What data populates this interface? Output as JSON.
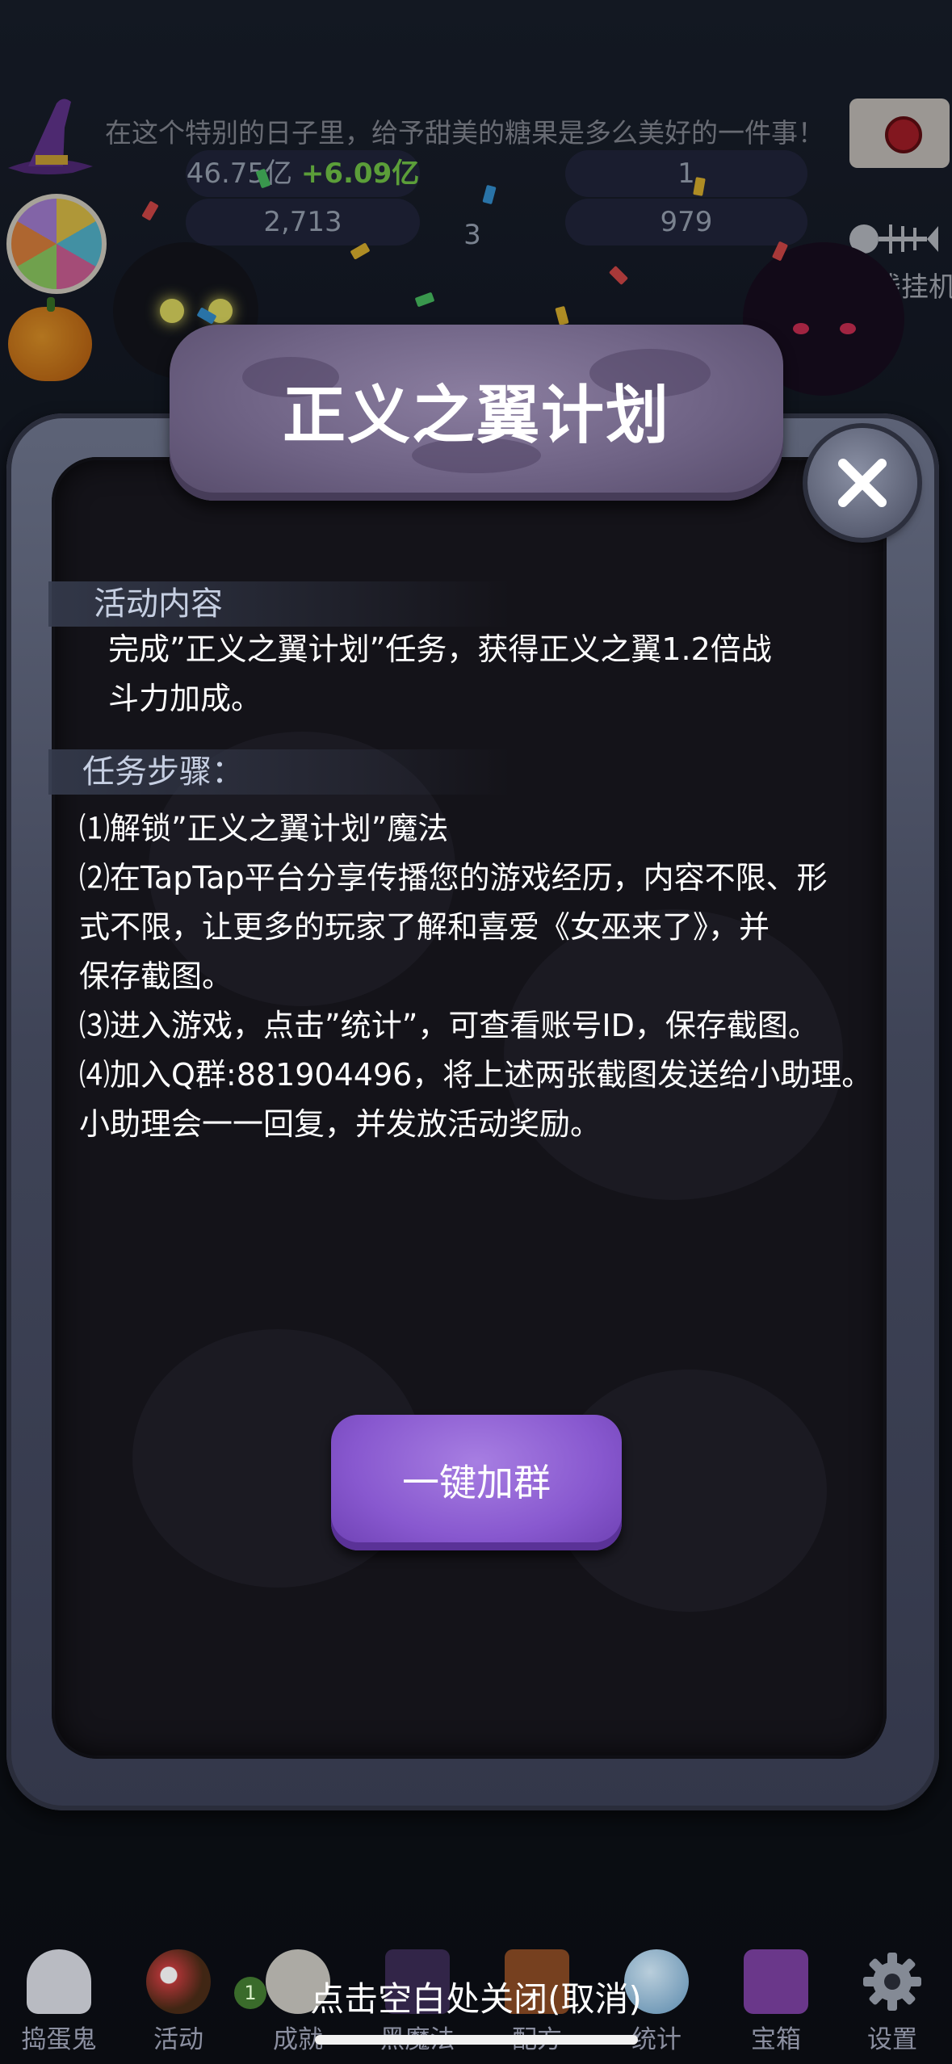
{
  "background": {
    "marquee": "在这个特别的日子里，给予甜美的糖果是多么美好的一件事！",
    "stats": {
      "coins": "46.75亿",
      "rate": "+6.09亿",
      "level": "1",
      "souls": "2,713",
      "cauldron": "3",
      "candy": "979"
    },
    "offline_label": "离线挂机"
  },
  "dialog": {
    "title": "正义之翼计划",
    "content_heading": "活动内容",
    "content_lines": [
      "完成”正义之翼计划”任务，获得正义之翼1.2倍战",
      "斗力加成。"
    ],
    "steps_heading": "任务步骤：",
    "steps_lines": [
      "⑴解锁”正义之翼计划”魔法",
      "⑵在TapTap平台分享传播您的游戏经历，内容不限、形",
      "式不限，让更多的玩家了解和喜爱《女巫来了》，并",
      "保存截图。",
      "⑶进入游戏，点击”统计”，可查看账号ID，保存截图。",
      "⑷加入Q群:881904496，将上述两张截图发送给小助理。",
      "小助理会一一回复，并发放活动奖励。"
    ],
    "join_button": "一键加群"
  },
  "tabbar": {
    "tabs": [
      {
        "label": "捣蛋鬼",
        "icon": "ghost-icon"
      },
      {
        "label": "活动",
        "icon": "eyeballs-icon"
      },
      {
        "label": "成就",
        "icon": "skull-icon"
      },
      {
        "label": "黑魔法",
        "icon": "spellbook-icon"
      },
      {
        "label": "配方",
        "icon": "recipe-icon"
      },
      {
        "label": "统计",
        "icon": "crystal-ball-icon"
      },
      {
        "label": "宝箱",
        "icon": "chest-icon"
      },
      {
        "label": "设置",
        "icon": "gear-icon"
      }
    ],
    "achievement_badge": "1"
  },
  "close_hint": "点击空白处关闭(取消)",
  "colors": {
    "accent_purple": "#8858cf",
    "plate_purple": "#6f6385",
    "panel_dark": "#141319",
    "frame_gray": "#4a4f63"
  }
}
